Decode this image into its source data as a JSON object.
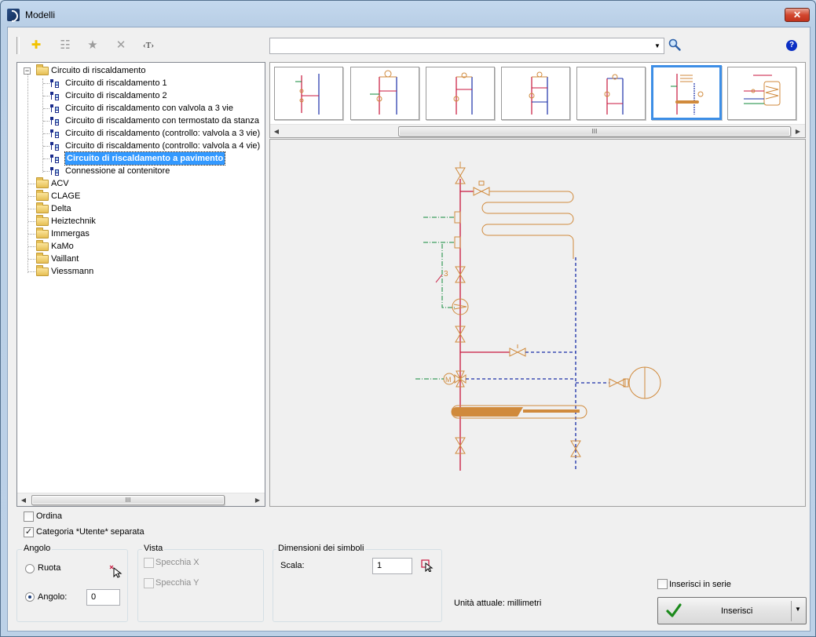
{
  "window": {
    "title": "Modelli",
    "close_label": "✕"
  },
  "toolbar": {
    "items": [
      {
        "name": "add-icon",
        "glyph": "✚",
        "color": "#f2c200"
      },
      {
        "name": "properties-icon",
        "glyph": "☷",
        "color": "#9c9c9c"
      },
      {
        "name": "favorite-icon",
        "glyph": "★",
        "color": "#9c9c9c"
      },
      {
        "name": "delete-icon",
        "glyph": "✕",
        "color": "#9c9c9c"
      },
      {
        "name": "text-tag-icon",
        "glyph": "‹T›",
        "color": "#222222"
      }
    ],
    "search_value": "",
    "search_placeholder": "",
    "combo_arrow": "▼",
    "help_label": "?"
  },
  "tree": {
    "root": {
      "label": "Circuito di riscaldamento",
      "expander": "−"
    },
    "children": [
      "Circuito di riscaldamento 1",
      "Circuito di riscaldamento 2",
      "Circuito di riscaldamento con valvola a 3 vie",
      "Circuito di riscaldamento con termostato da stanza",
      "Circuito di riscaldamento (controllo: valvola a 3 vie)",
      "Circuito di riscaldamento (controllo: valvola a 4 vie)",
      "Circuito di riscaldamento a pavimento",
      "Connessione al contenitore"
    ],
    "selected_child": "Circuito di riscaldamento a pavimento",
    "folders": [
      "ACV",
      "CLAGE",
      "Delta",
      "Heiztechnik",
      "Immergas",
      "KaMo",
      "Vaillant",
      "Viessmann"
    ],
    "scroll_grip": "III",
    "arrow_left": "◀",
    "arrow_right": "▶"
  },
  "thumbnails": {
    "count_visible": 7,
    "selected_index": 5
  },
  "options": {
    "sort_label": "Ordina",
    "sort_checked": false,
    "separate_label": "Categoria *Utente* separata",
    "separate_checked": true,
    "checkmark": "✓"
  },
  "angle": {
    "title": "Angolo",
    "rotate_label": "Ruota",
    "angle_label": "Angolo:",
    "angle_value": "0",
    "selected": "Angolo"
  },
  "view": {
    "title": "Vista",
    "mirror_x_label": "Specchia X",
    "mirror_y_label": "Specchia Y"
  },
  "symbols": {
    "title": "Dimensioni dei simboli",
    "scale_label": "Scala:",
    "scale_value": "1"
  },
  "units_label": "Unità attuale: millimetri",
  "series_label": "Inserisci in serie",
  "insert_label": "Inserisci",
  "colors": {
    "accent": "#3399ff",
    "pipe_red": "#c8163c",
    "pipe_blue": "#1a2fa8",
    "symbol_tan": "#d08a3c",
    "control_green": "#0f8a3a"
  }
}
